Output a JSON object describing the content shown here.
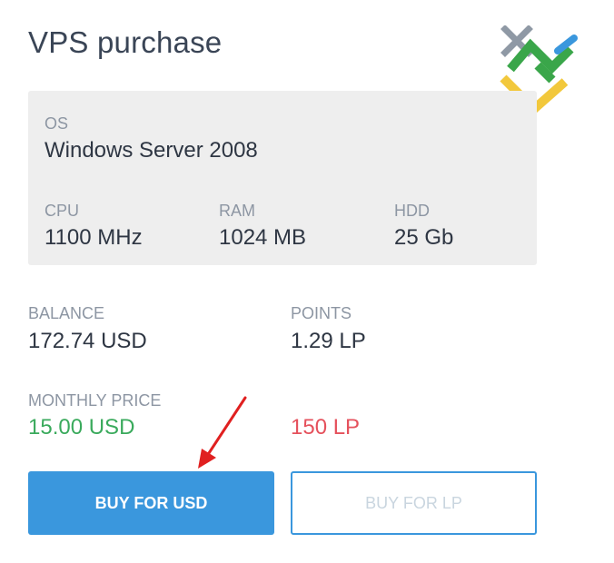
{
  "title": "VPS purchase",
  "specs": {
    "os": {
      "label": "OS",
      "value": "Windows Server 2008"
    },
    "cpu": {
      "label": "CPU",
      "value": "1100 MHz"
    },
    "ram": {
      "label": "RAM",
      "value": "1024 MB"
    },
    "hdd": {
      "label": "HDD",
      "value": "25 Gb"
    }
  },
  "balance": {
    "label": "BALANCE",
    "value": "172.74 USD"
  },
  "points": {
    "label": "POINTS",
    "value": "1.29 LP"
  },
  "monthly_price": {
    "label": "MONTHLY PRICE",
    "usd": "15.00 USD",
    "lp": "150 LP"
  },
  "buttons": {
    "buy_usd": "BUY FOR USD",
    "buy_lp": "BUY FOR LP"
  },
  "colors": {
    "accent": "#3a97dd",
    "price_usd": "#3aaa5c",
    "price_lp": "#e5515c",
    "annotation_arrow": "#e02020"
  },
  "icons": {
    "logo": "livepoint-logo-icon",
    "annotation": "red-arrow-icon"
  }
}
